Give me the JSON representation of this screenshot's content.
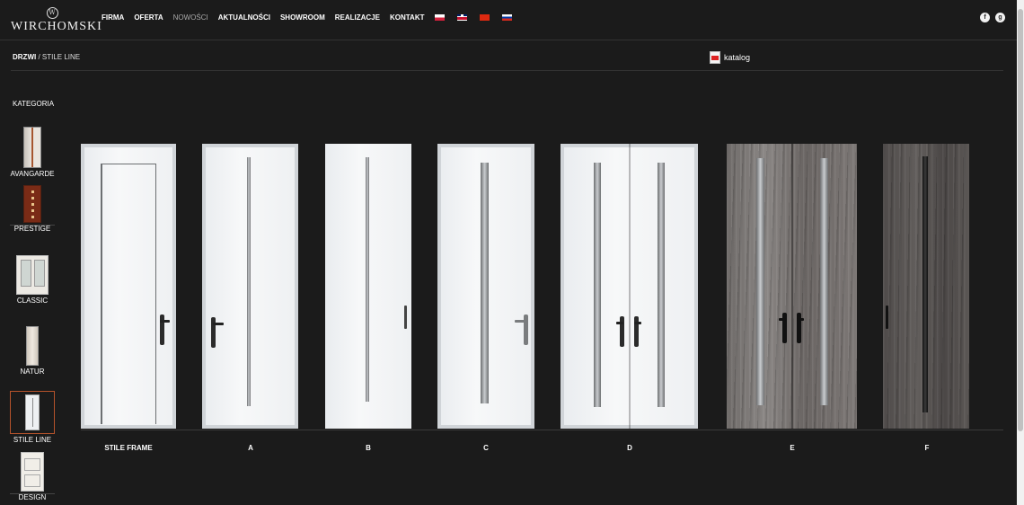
{
  "brand": {
    "logo_text": "WIRCHOMSKI",
    "logo_mark": "W"
  },
  "nav": {
    "items": [
      "FIRMA",
      "OFERTA",
      "NOWOŚCI",
      "AKTUALNOŚCI",
      "SHOWROOM",
      "REALIZACJE",
      "KONTAKT"
    ],
    "active_dim": "NOWOŚCI",
    "languages": [
      "pl",
      "en",
      "cn",
      "ru"
    ]
  },
  "social": {
    "facebook": "f",
    "googleplus": "g"
  },
  "breadcrumb": {
    "parent": "DRZWI",
    "separator": " / ",
    "current": "STILE LINE"
  },
  "katalog": {
    "label": "katalog",
    "icon": "pdf-icon"
  },
  "sidebar": {
    "heading": "KATEGORIA",
    "items": [
      {
        "label": "AVANGARDE"
      },
      {
        "label": "PRESTIGE"
      },
      {
        "label": "CLASSIC"
      },
      {
        "label": "NATUR"
      },
      {
        "label": "STILE LINE",
        "selected": true
      },
      {
        "label": "DESIGN"
      }
    ]
  },
  "doors": [
    {
      "label": "STILE FRAME",
      "finish": "white"
    },
    {
      "label": "A",
      "finish": "white"
    },
    {
      "label": "B",
      "finish": "white"
    },
    {
      "label": "C",
      "finish": "white"
    },
    {
      "label": "D",
      "finish": "white-double"
    },
    {
      "label": "E",
      "finish": "grey-wood-double"
    },
    {
      "label": "F",
      "finish": "dark-wood"
    }
  ],
  "colors": {
    "background": "#1b1b1b",
    "accent_selected": "#b5532b"
  }
}
